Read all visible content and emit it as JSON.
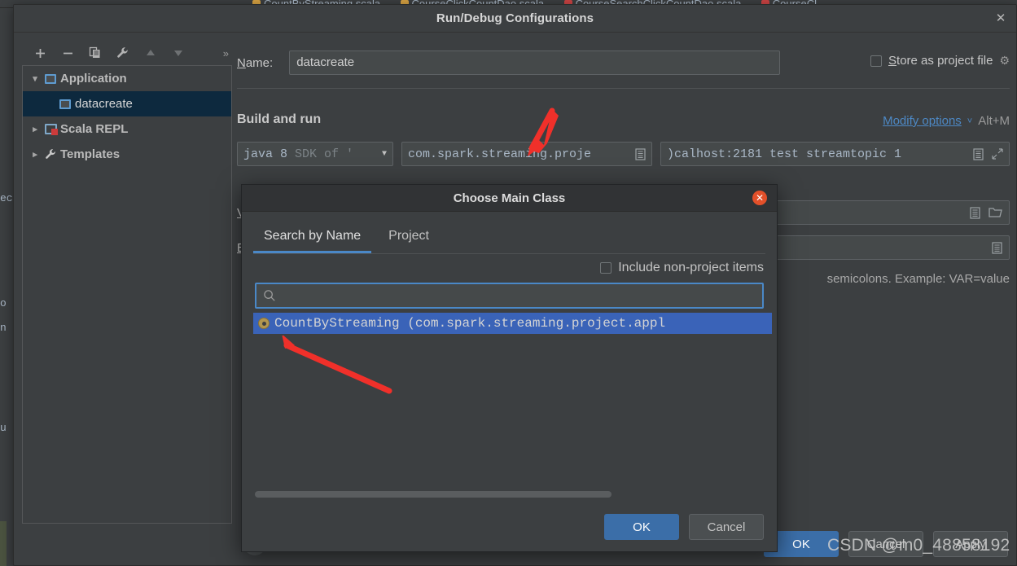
{
  "ide": {
    "tabs": [
      {
        "label": "CountByStreaming.scala",
        "icon": "scala-file-icon",
        "color": "#d9a343"
      },
      {
        "label": "CourseClickCountDao.scala",
        "icon": "scala-file-icon",
        "color": "#d9a343"
      },
      {
        "label": "CourseSearchClickCountDao.scala",
        "icon": "scala-file-icon",
        "color": "#cc4444"
      },
      {
        "label": "CourseCl",
        "icon": "scala-file-icon",
        "color": "#cc4444"
      }
    ],
    "left_fragments": [
      "ec",
      "o",
      "n",
      "u"
    ]
  },
  "run_debug": {
    "title": "Run/Debug Configurations",
    "close_label": "✕",
    "toolbar": {
      "add": "+",
      "remove": "−",
      "copy": "copy-configuration",
      "edit_templates": "wrench",
      "move_up": "▲",
      "move_down": "▼",
      "more": "»"
    },
    "tree": [
      {
        "label": "Application",
        "expanded": true,
        "icon": "application-icon",
        "selected": false,
        "depth": 0
      },
      {
        "label": "datacreate",
        "expanded": false,
        "icon": "application-icon",
        "selected": true,
        "depth": 1
      },
      {
        "label": "Scala REPL",
        "expanded": false,
        "icon": "scala-repl-icon",
        "selected": false,
        "depth": 0
      },
      {
        "label": "Templates",
        "expanded": false,
        "icon": "wrench-icon",
        "selected": false,
        "depth": 0
      }
    ],
    "name_label": "Name:",
    "name_label_mnemonic": "N",
    "name_value": "datacreate",
    "store_as_project_file": {
      "label": "Store as project file",
      "mnemonic": "S",
      "checked": false,
      "gear": "gear-icon"
    },
    "section_title": "Build and run",
    "modify_options": {
      "link": "Modify options",
      "caret": "˅",
      "shortcut": "Alt+M"
    },
    "sdk_field": {
      "value_bold": "java 8",
      "value_muted": "SDK of '",
      "caret": "▼"
    },
    "main_class_field": {
      "value": "com.spark.streaming.proje",
      "browse_icon": "list-icon"
    },
    "program_args_field": {
      "value": ")calhost:2181 test streamtopic 1",
      "list_icon": "list-icon",
      "expand_icon": "expand-icon"
    },
    "vm_options_label": "V",
    "env_vars_label": "E",
    "env_hint": "semicolons. Example: VAR=value",
    "help_button": "?",
    "footer": {
      "ok": "OK",
      "cancel": "Cancel",
      "apply": "Apply"
    }
  },
  "choose_main_class": {
    "title": "Choose Main Class",
    "close_label": "✕",
    "tabs": [
      {
        "label": "Search by Name",
        "active": true
      },
      {
        "label": "Project",
        "active": false
      }
    ],
    "include_non_project": {
      "label": "Include non-project items",
      "checked": false
    },
    "search": {
      "value": "",
      "placeholder": "",
      "icon": "search-icon"
    },
    "results": [
      {
        "label": "CountByStreaming (com.spark.streaming.project.appl",
        "icon": "class-object-icon",
        "selected": true
      }
    ],
    "footer": {
      "ok": "OK",
      "cancel": "Cancel"
    }
  },
  "annotations": {
    "arrow_color": "#f0302a",
    "arrows": [
      {
        "name": "arrow-to-main-class-field"
      },
      {
        "name": "arrow-to-result-item"
      }
    ]
  },
  "watermark": "CSDN @m0_48858192"
}
